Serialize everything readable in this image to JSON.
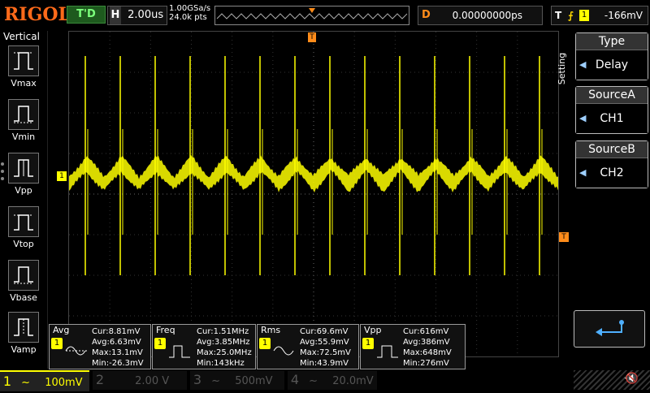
{
  "header": {
    "logo": "RIGOL",
    "run_state": "T'D",
    "horizontal_label": "H",
    "horizontal_scale": "2.00us",
    "sample_rate": "1.00GSa/s",
    "memory_depth": "24.0k pts",
    "delay_label": "D",
    "delay_value": "0.00000000ps",
    "trigger_label": "T",
    "trigger_edge_icon": "rising-edge-icon",
    "trigger_source": "1",
    "trigger_level": "-166mV"
  },
  "left_panel": {
    "title": "Vertical",
    "items": [
      {
        "label": "Vmax",
        "icon": "vmax-icon"
      },
      {
        "label": "Vmin",
        "icon": "vmin-icon"
      },
      {
        "label": "Vpp",
        "icon": "vpp-icon"
      },
      {
        "label": "Vtop",
        "icon": "vtop-icon"
      },
      {
        "label": "Vbase",
        "icon": "vbase-icon"
      },
      {
        "label": "Vamp",
        "icon": "vamp-icon"
      }
    ]
  },
  "waveform": {
    "channel_marker": "1",
    "trigger_marker": "T",
    "color": "#ffff00",
    "spike_count": 14
  },
  "right_panel": {
    "setting_label": "Setting",
    "boxes": [
      {
        "title": "Type",
        "value": "Delay"
      },
      {
        "title": "SourceA",
        "value": "CH1"
      },
      {
        "title": "SourceB",
        "value": "CH2"
      }
    ],
    "enter_icon": "enter-icon"
  },
  "measurements": [
    {
      "name": "Avg",
      "channel": "1",
      "cur": "Cur:8.81mV",
      "avg": "Avg:6.63mV",
      "max": "Max:13.1mV",
      "min": "Min:-26.3mV"
    },
    {
      "name": "Freq",
      "channel": "1",
      "cur": "Cur:1.51MHz",
      "avg": "Avg:3.85MHz",
      "max": "Max:25.0MHz",
      "min": "Min:143kHz"
    },
    {
      "name": "Rms",
      "channel": "1",
      "cur": "Cur:69.6mV",
      "avg": "Avg:55.9mV",
      "max": "Max:72.5mV",
      "min": "Min:43.9mV"
    },
    {
      "name": "Vpp",
      "channel": "1",
      "cur": "Cur:616mV",
      "avg": "Avg:386mV",
      "max": "Max:648mV",
      "min": "Min:276mV"
    }
  ],
  "channels": [
    {
      "num": "1",
      "coupling": "~",
      "scale": "100mV",
      "color": "#ffff00"
    },
    {
      "num": "2",
      "coupling": "",
      "scale": "2.00 V",
      "color": "#00c8ff"
    },
    {
      "num": "3",
      "coupling": "~",
      "scale": "500mV",
      "color": "#ff00ff"
    },
    {
      "num": "4",
      "coupling": "~",
      "scale": "20.0mV",
      "color": "#3a6bff"
    }
  ],
  "status_icons": [
    "usb-icon",
    "speaker-mute-icon"
  ]
}
